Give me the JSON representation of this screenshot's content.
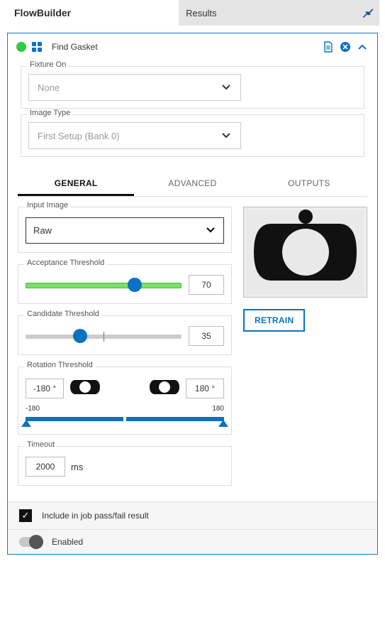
{
  "app": {
    "title": "FlowBuilder"
  },
  "results_bar": {
    "label": "Results"
  },
  "panel": {
    "title": "Find Gasket"
  },
  "fixture": {
    "label": "Fixture On",
    "value": "None"
  },
  "image_type": {
    "label": "Image Type",
    "value": "First Setup (Bank 0)"
  },
  "tabs": {
    "general": "GENERAL",
    "advanced": "ADVANCED",
    "outputs": "OUTPUTS",
    "active": "general"
  },
  "input_image": {
    "label": "Input Image",
    "value": "Raw"
  },
  "acceptance": {
    "label": "Acceptance Threshold",
    "value": 70,
    "min": 0,
    "max": 100
  },
  "candidate": {
    "label": "Candidate Threshold",
    "value": 35,
    "min": 0,
    "max": 100
  },
  "rotation": {
    "label": "Rotation Threshold",
    "min_value": "-180 °",
    "max_value": "180  °",
    "scale_min": "-180",
    "scale_max": "180"
  },
  "timeout": {
    "label": "Timeout",
    "value": 2000,
    "unit": "ms"
  },
  "retrain": {
    "label": "RETRAIN"
  },
  "include": {
    "label": "Include in job pass/fail result",
    "checked": true
  },
  "enabled": {
    "label": "Enabled",
    "on": true
  }
}
